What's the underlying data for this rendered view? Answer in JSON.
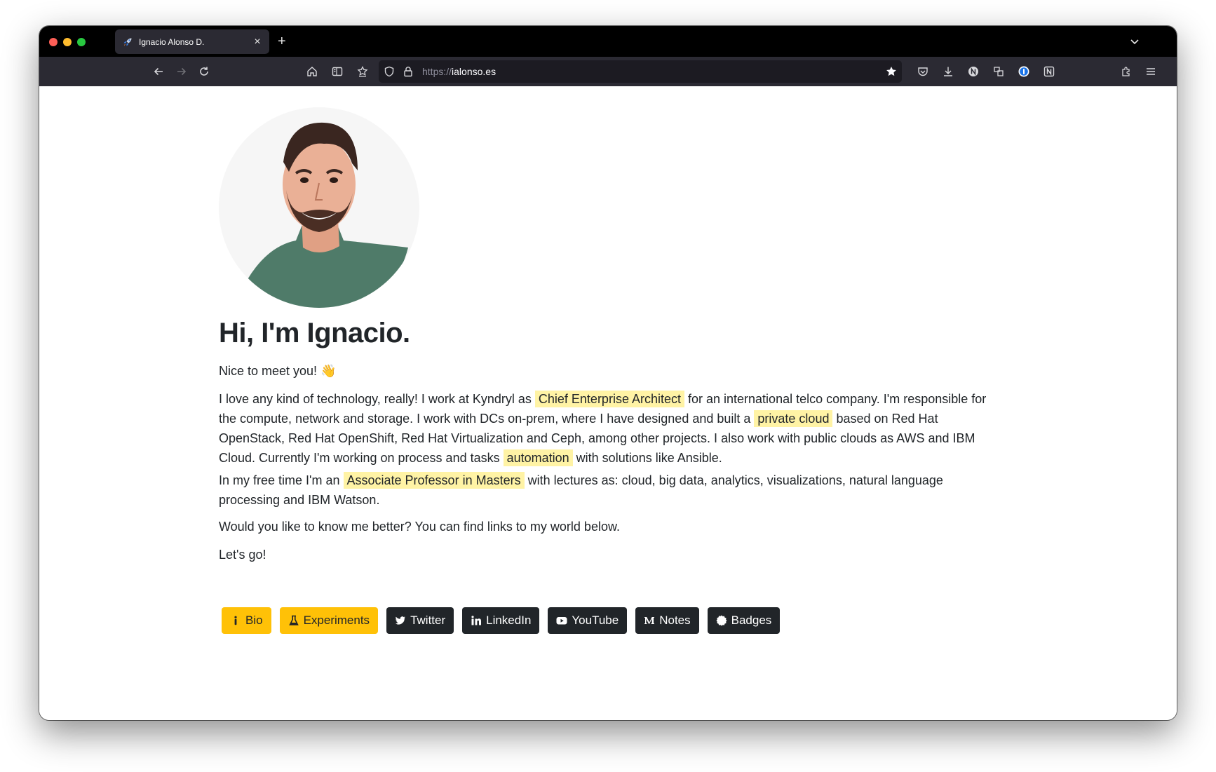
{
  "browser": {
    "tab": {
      "title": "Ignacio Alonso D.",
      "favicon": "rocket-icon",
      "close": "×"
    },
    "new_tab": "+",
    "url": {
      "scheme": "https://",
      "host": "ialonso.es"
    }
  },
  "page": {
    "heading": "Hi, I'm Ignacio.",
    "greeting": "Nice to meet you! 👋",
    "p1": {
      "a": "I love any kind of technology, really! I work at Kyndryl as ",
      "hl1": "Chief Enterprise Architect",
      "b": " for an international telco company. I'm responsible for the compute, network and storage. I work with DCs on-prem, where I have designed and built a ",
      "hl2": "private cloud",
      "c": " based on Red Hat OpenStack, Red Hat OpenShift, Red Hat Virtualization and Ceph, among other projects. I also work with public clouds as AWS and IBM Cloud. Currently I'm working on process and tasks ",
      "hl3": "automation",
      "d": " with solutions like Ansible."
    },
    "p2": {
      "a": "In my free time I'm an ",
      "hl": "Associate Professor in Masters",
      "b": " with lectures as: cloud, big data, analytics, visualizations, natural language processing and IBM Watson."
    },
    "p3": "Would you like to know me better? You can find links to my world below.",
    "p4": "Let's go!",
    "buttons": {
      "bio": "Bio",
      "experiments": "Experiments",
      "twitter": "Twitter",
      "linkedin": "LinkedIn",
      "youtube": "YouTube",
      "notes": "Notes",
      "badges": "Badges"
    }
  },
  "colors": {
    "highlight": "#fff3a5",
    "warning_button": "#ffc107",
    "dark_button": "#212529",
    "text": "#212529"
  }
}
